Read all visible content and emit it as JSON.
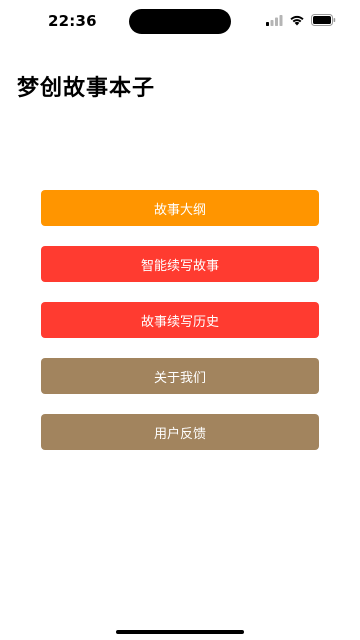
{
  "status_bar": {
    "time": "22:36"
  },
  "app": {
    "title": "梦创故事本子"
  },
  "menu": {
    "buttons": [
      {
        "label": "故事大纲",
        "color": "#FF9500"
      },
      {
        "label": "智能续写故事",
        "color": "#FF3B30"
      },
      {
        "label": "故事续写历史",
        "color": "#FF3B30"
      },
      {
        "label": "关于我们",
        "color": "#A2845E"
      },
      {
        "label": "用户反馈",
        "color": "#A2845E"
      }
    ]
  }
}
